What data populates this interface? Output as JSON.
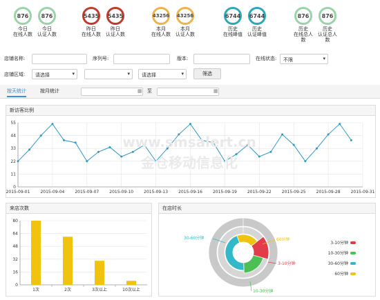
{
  "stats": [
    {
      "value": "876",
      "label": "今日\n在线人数",
      "color": "#9bd3a8"
    },
    {
      "value": "876",
      "label": "今日\n认证人数",
      "color": "#9bd3a8"
    },
    {
      "value": "5435",
      "label": "昨日\n在线人数",
      "color": "#c0392b"
    },
    {
      "value": "5435",
      "label": "昨日\n认证人数",
      "color": "#c0392b"
    },
    {
      "value": "43256",
      "label": "本月\n在线人数",
      "color": "#f0b24a"
    },
    {
      "value": "43256",
      "label": "本月\n认证人数",
      "color": "#f0b24a"
    },
    {
      "value": "6744",
      "label": "历史\n在线峰值",
      "color": "#2aa8b8"
    },
    {
      "value": "6744",
      "label": "历史\n认证峰值",
      "color": "#2aa8b8"
    },
    {
      "value": "876",
      "label": "历史\n在线总人\n数",
      "color": "#9bd3a8"
    },
    {
      "value": "876",
      "label": "历史\n认证总人\n数",
      "color": "#9bd3a8"
    }
  ],
  "filters": {
    "shop_name_label": "店铺名称:",
    "serial_label": "序列号:",
    "version_label": "版本:",
    "online_status_label": "在线状态:",
    "online_status_value": "不限",
    "region_label": "店铺区域:",
    "region_select_1": "请选择",
    "region_select_2": "",
    "region_select_3": "请选择",
    "filter_button": "筛选"
  },
  "tabs": {
    "daily": "按天统计",
    "monthly": "按月统计",
    "to": "至"
  },
  "line_panel": {
    "title": "新访客比例"
  },
  "bar_panel": {
    "title": "来店次数"
  },
  "donut_panel": {
    "title": "在店时长"
  },
  "watermark": {
    "line1": "www.smsalert.cn",
    "line2": "金仓移动信息化"
  },
  "chart_data": [
    {
      "type": "line",
      "x": [
        "2015-09-01",
        "2015-09-02",
        "2015-09-03",
        "2015-09-04",
        "2015-09-05",
        "2015-09-06",
        "2015-09-07",
        "2015-09-08",
        "2015-09-09",
        "2015-09-10",
        "2015-09-11",
        "2015-09-12",
        "2015-09-13",
        "2015-09-14",
        "2015-09-15",
        "2015-09-16",
        "2015-09-17",
        "2015-09-18",
        "2015-09-19",
        "2015-09-20",
        "2015-09-21",
        "2015-09-22",
        "2015-09-23",
        "2015-09-24",
        "2015-09-25",
        "2015-09-26",
        "2015-09-27",
        "2015-09-28",
        "2015-09-29",
        "2015-09-30",
        "2015-09-31"
      ],
      "x_ticks": [
        "2015-09-01",
        "2015-09-04",
        "2015-09-07",
        "2015-09-10",
        "2015-09-13",
        "2015-09-16",
        "2015-09-19",
        "2015-09-22",
        "2015-09-25",
        "2015-09-28",
        "2015-09-31"
      ],
      "y": [
        22,
        32,
        44,
        54,
        40,
        38,
        22,
        30,
        34,
        26,
        30,
        36,
        22,
        33,
        45,
        54,
        40,
        38,
        22,
        28,
        36,
        26,
        30,
        45,
        36,
        22,
        33,
        45,
        54,
        40
      ],
      "ylim": [
        0,
        55
      ],
      "y_ticks": [
        0,
        11,
        22,
        33,
        44,
        55
      ],
      "color": "#2b98c8",
      "grid": true
    },
    {
      "type": "bar",
      "categories": [
        "1次",
        "2次",
        "3次以上",
        "10次以上"
      ],
      "values": [
        80,
        60,
        30,
        5
      ],
      "ylim": [
        0,
        80
      ],
      "y_ticks": [
        0,
        16,
        32,
        48,
        64,
        80
      ],
      "color": "#f0c30f",
      "grid": true
    },
    {
      "type": "pie",
      "categories": [
        "3-10分钟",
        "10-30分钟",
        "30-60分钟",
        "60分钟"
      ],
      "inner_values": [
        15,
        20,
        45,
        20
      ],
      "outer_values": [],
      "colors": [
        "#e23b4a",
        "#4cbf55",
        "#32b9c8",
        "#f0c30f"
      ],
      "legend": [
        "3-10分钟",
        "10-30分钟",
        "30-60分钟",
        "60分钟"
      ],
      "legend_position": "right"
    }
  ]
}
